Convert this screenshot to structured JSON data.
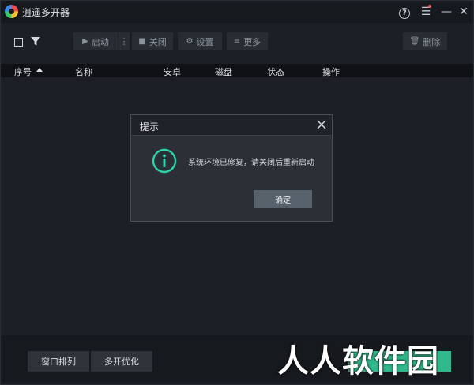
{
  "app": {
    "title": "逍遥多开器"
  },
  "titlebar": {
    "help_glyph": "?",
    "menu_glyph": "☰",
    "minimize_glyph": "—",
    "close_glyph": "✕"
  },
  "toolbar": {
    "start_label": "启动",
    "more_start_glyph": "⋮",
    "close_label": "关闭",
    "settings_label": "设置",
    "more_label": "更多",
    "delete_label": "删除"
  },
  "table": {
    "columns": [
      "序号",
      "名称",
      "安卓",
      "磁盘",
      "状态",
      "操作"
    ]
  },
  "dialog": {
    "title": "提示",
    "message": "系统环境已修复，请关闭后重新启动",
    "ok_label": "确定"
  },
  "footer": {
    "arrange_label": "窗口排列",
    "optimize_label": "多开优化"
  },
  "watermark": {
    "text": "人人软件园"
  },
  "colors": {
    "accent": "#2fd3a9",
    "background": "#1c1f25",
    "header": "#0f1115",
    "button": "#282c33"
  }
}
